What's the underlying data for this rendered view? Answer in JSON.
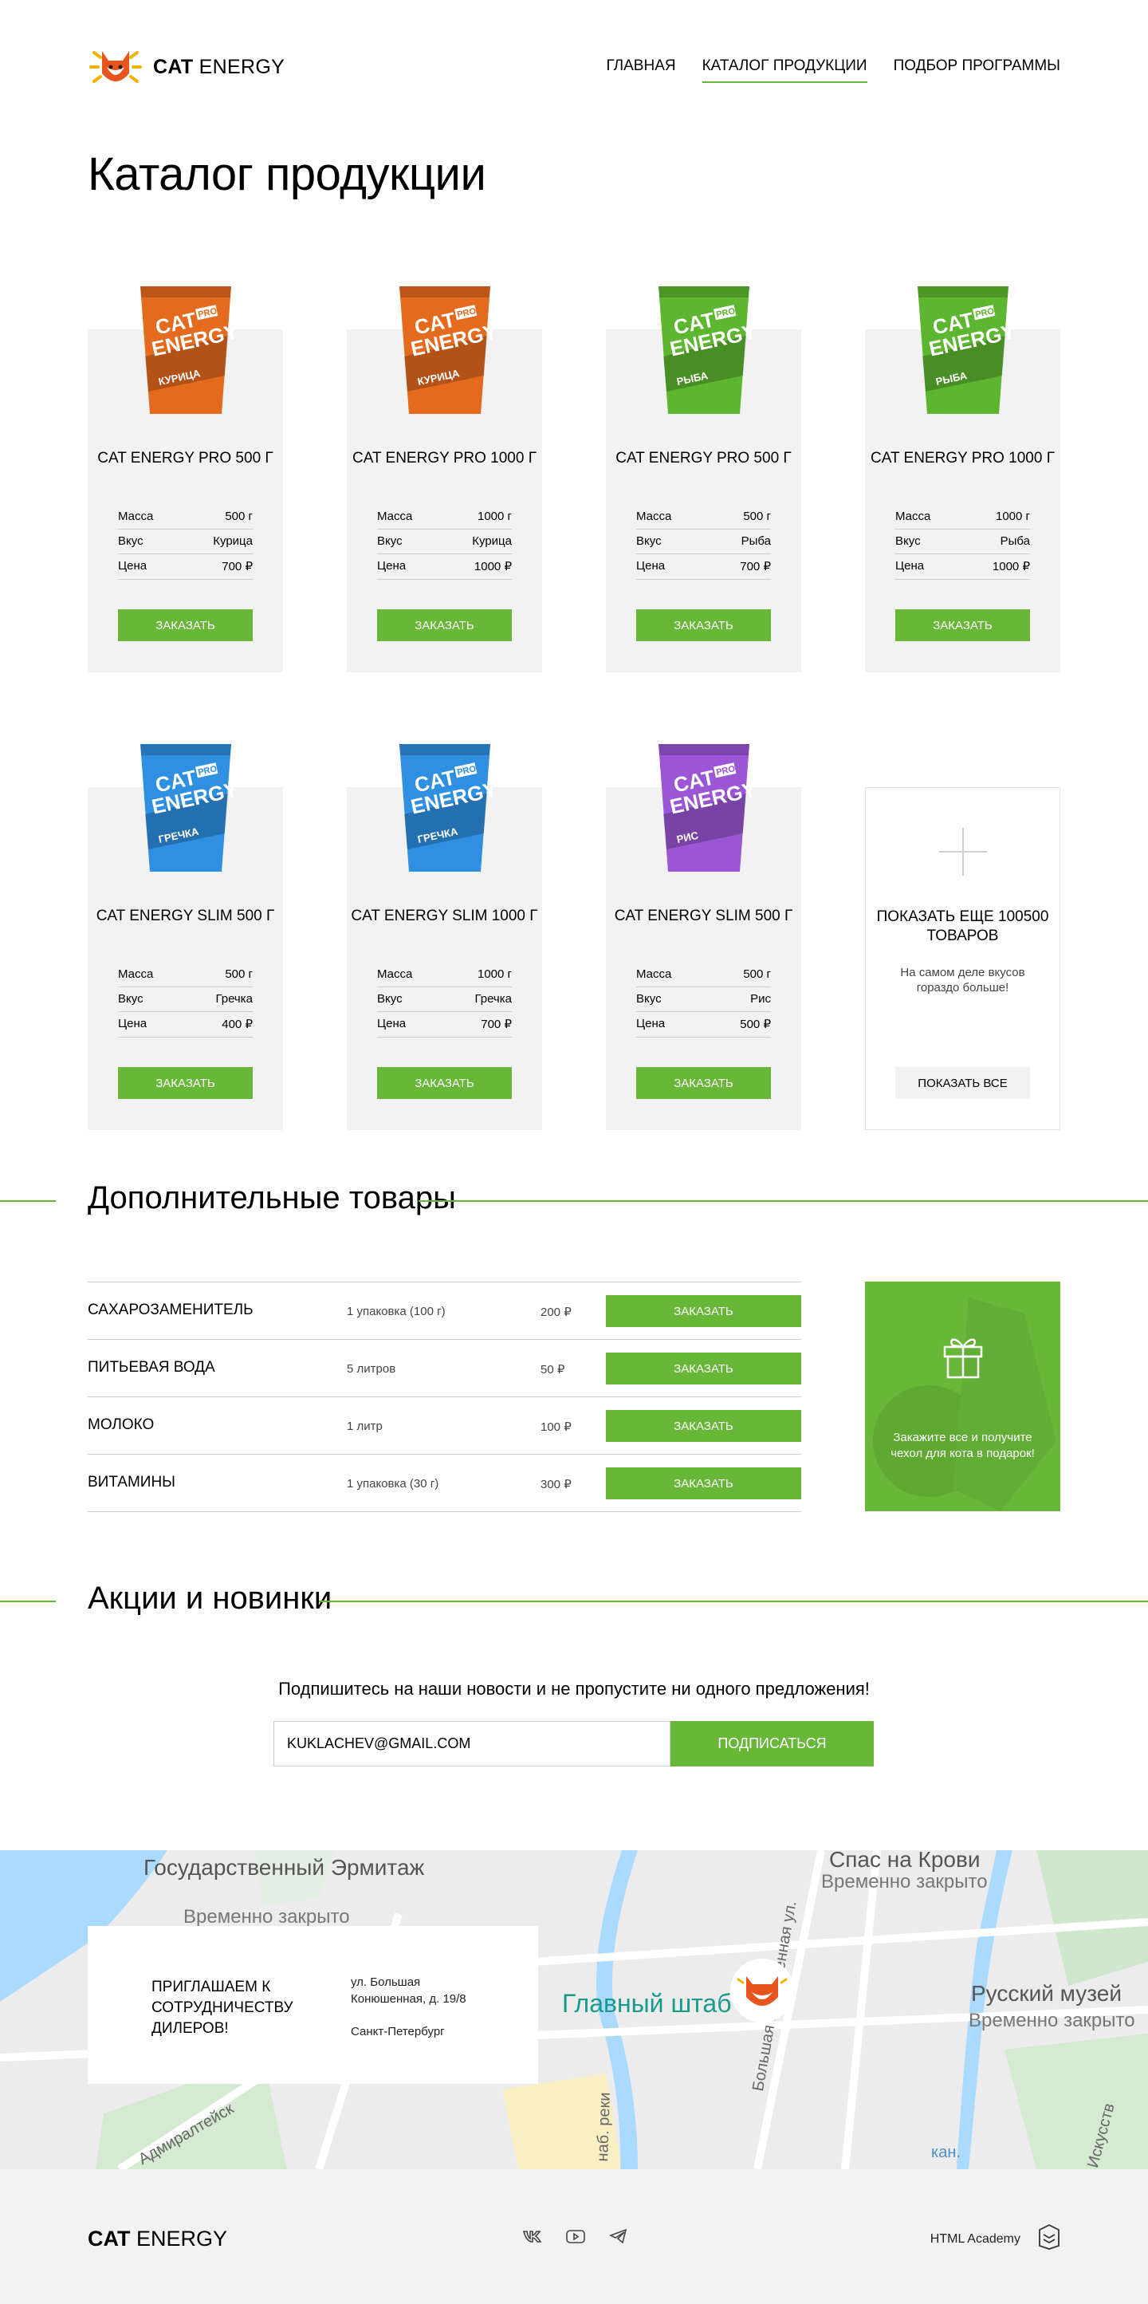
{
  "brand": {
    "name_bold": "CAT",
    "name_rest": " ENERGY"
  },
  "nav": [
    {
      "label": "Главная"
    },
    {
      "label": "Каталог продукции"
    },
    {
      "label": "Подбор программы"
    }
  ],
  "page_title": "Каталог продукции",
  "products": [
    {
      "name": "Cat Energy Pro 500 г",
      "mass": "500 г",
      "taste": "Курица",
      "price": "700 ₽",
      "pack_color": "#e46a1e",
      "pack_label": "Курица"
    },
    {
      "name": "Cat Energy Pro 1000 г",
      "mass": "1000 г",
      "taste": "Курица",
      "price": "1000 ₽",
      "pack_color": "#e46a1e",
      "pack_label": "Курица"
    },
    {
      "name": "Cat Energy Pro 500 г",
      "mass": "500 г",
      "taste": "Рыба",
      "price": "700 ₽",
      "pack_color": "#5db630",
      "pack_label": "Рыба"
    },
    {
      "name": "Cat Energy Pro 1000 г",
      "mass": "1000 г",
      "taste": "Рыба",
      "price": "1000 ₽",
      "pack_color": "#5db630",
      "pack_label": "Рыба"
    },
    {
      "name": "Cat Energy Slim 500 г",
      "mass": "500 г",
      "taste": "Гречка",
      "price": "400 ₽",
      "pack_color": "#2f8fe0",
      "pack_label": "Гречка"
    },
    {
      "name": "Cat Energy Slim 1000 г",
      "mass": "1000 г",
      "taste": "Гречка",
      "price": "700 ₽",
      "pack_color": "#2f8fe0",
      "pack_label": "Гречка"
    },
    {
      "name": "Cat Energy Slim 500 г",
      "mass": "500 г",
      "taste": "Рис",
      "price": "500 ₽",
      "pack_color": "#9a56d4",
      "pack_label": "Рис"
    }
  ],
  "spec_labels": {
    "mass": "Масса",
    "taste": "Вкус",
    "price": "Цена"
  },
  "order_label": "Заказать",
  "pack_brand": {
    "line1": "CAT",
    "line2": "ENERGY",
    "pro": "PRO"
  },
  "more_card": {
    "title": "Показать еще 100500 товаров",
    "desc": "На самом деле вкусов гораздо больше!",
    "button": "Показать все"
  },
  "extras_title": "Дополнительные товары",
  "extras": [
    {
      "name": "Сахарозаменитель",
      "qty": "1 упаковка (100 г)",
      "price": "200 ₽"
    },
    {
      "name": "Питьевая вода",
      "qty": "5 литров",
      "price": "50 ₽"
    },
    {
      "name": "Молоко",
      "qty": "1 литр",
      "price": "100 ₽"
    },
    {
      "name": "Витамины",
      "qty": "1 упаковка (30 г)",
      "price": "300 ₽"
    }
  ],
  "promo_text": "Закажите все и получите чехол для кота в подарок!",
  "news_title": "Акции и новинки",
  "subscribe": {
    "text": "Подпишитесь на наши новости и не пропустите ни одного предложения!",
    "value": "kuklachev@gmail.com",
    "button": "Подписаться"
  },
  "map_labels": {
    "hermitage": "Государственный Эрмитаж",
    "hermitage_status": "Временно закрыто",
    "savior": "Спас на Крови",
    "savior_status": "Временно закрыто",
    "main_staff": "Главный штаб",
    "russian_museum": "Русский музей",
    "russian_status": "Временно закрыто",
    "street1": "Большая Конюшенная ул.",
    "street2": "наб. реки",
    "street3": "Адмиралтейск",
    "street4": "кан.",
    "street5": "Искусств"
  },
  "dealer": {
    "title": "Приглашаем к сотрудничеству дилеров!",
    "address": "ул. Большая Конюшенная, д. 19/8",
    "city": "Санкт-Петербург"
  },
  "footer": {
    "academy": "HTML Academy"
  },
  "colors": {
    "accent": "#68b738",
    "card_bg": "#f2f2f2"
  }
}
